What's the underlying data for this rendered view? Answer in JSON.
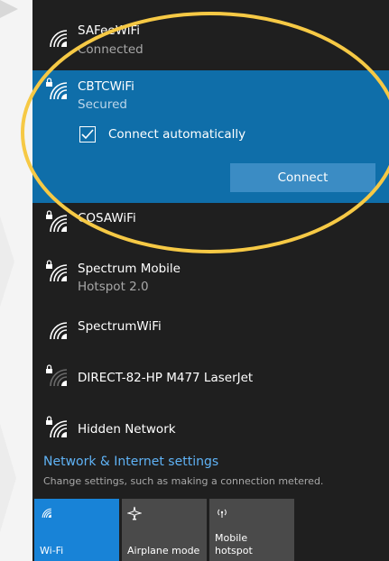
{
  "networks": [
    {
      "name": "SAFeeWiFi",
      "status": "Connected",
      "secured": false
    },
    {
      "name": "CBTCWiFi",
      "status": "Secured",
      "secured": true,
      "selected": true
    },
    {
      "name": "COSAWiFi",
      "status": "",
      "secured": true
    },
    {
      "name": "Spectrum Mobile",
      "status": "Hotspot 2.0",
      "secured": true
    },
    {
      "name": "SpectrumWiFi",
      "status": "",
      "secured": false
    },
    {
      "name": "DIRECT-82-HP M477 LaserJet",
      "status": "",
      "secured": true
    },
    {
      "name": "Hidden Network",
      "status": "",
      "secured": true
    }
  ],
  "selected_network": {
    "auto_connect_label": "Connect automatically",
    "auto_connect_checked": true,
    "connect_label": "Connect"
  },
  "settings": {
    "link_label": "Network & Internet settings",
    "description": "Change settings, such as making a connection metered."
  },
  "quick_actions": [
    {
      "label": "Wi-Fi",
      "icon": "wifi-icon",
      "active": true
    },
    {
      "label": "Airplane mode",
      "icon": "airplane-icon",
      "active": false
    },
    {
      "label": "Mobile hotspot",
      "label_line1": "Mobile",
      "label_line2": "hotspot",
      "icon": "mobile-hotspot-icon",
      "active": false
    }
  ],
  "colors": {
    "panel_bg": "#1f1f1f",
    "selected_bg": "#0f6ea9",
    "connect_button": "#3b8cc4",
    "link": "#5fb2f5",
    "annotation_ellipse": "#f6c945",
    "quick_action_active": "#1883d7",
    "quick_action_inactive": "#4a4a4a"
  }
}
